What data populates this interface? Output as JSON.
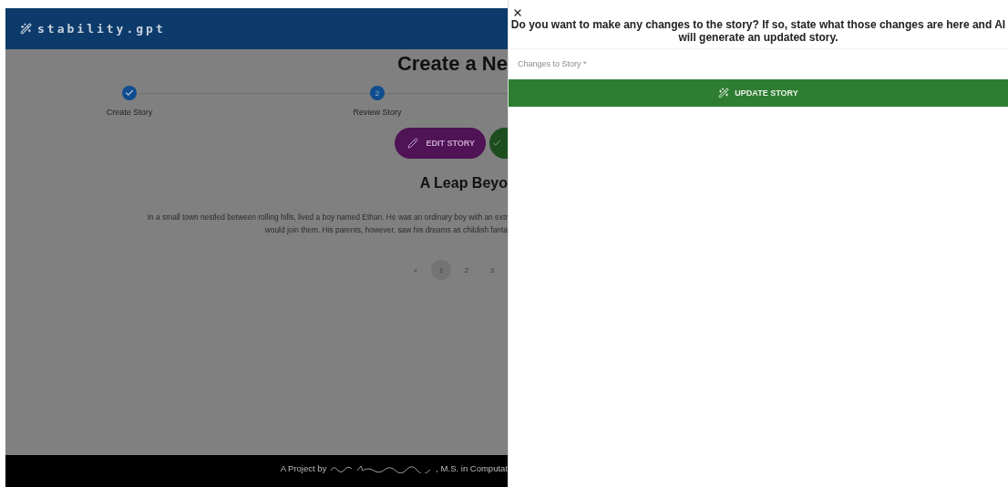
{
  "header": {
    "logo": "stability.gpt"
  },
  "page": {
    "title": "Create a Ne",
    "steps": [
      {
        "label": "Create Story",
        "completed": true
      },
      {
        "label": "Review Story",
        "number": "2",
        "completed": false
      }
    ],
    "actions": [
      {
        "kind": "edit",
        "label": "EDIT STORY"
      },
      {
        "kind": "confirm"
      }
    ],
    "story_title": "A Leap Beyo",
    "story_lines": [
      "In a small town nestled between rolling hills, lived a boy named Ethan. He was an ordinary boy with an extr",
      "would join them. His parents, however, saw his dreams as childish fanta"
    ],
    "pagination": [
      {
        "label": "<",
        "selected": false
      },
      {
        "label": "1",
        "selected": true
      },
      {
        "label": "2",
        "selected": false
      },
      {
        "label": "3",
        "selected": false
      }
    ]
  },
  "footer": {
    "prefix": "A Project by",
    "suffix": ", M.S. in Computat"
  },
  "drawer": {
    "question": "Do you want to make any changes to the story? If so, state what those changes are here and AI will generate an updated story.",
    "field": {
      "placeholder": "Changes to Story *"
    },
    "button": "UPDATE STORY"
  }
}
